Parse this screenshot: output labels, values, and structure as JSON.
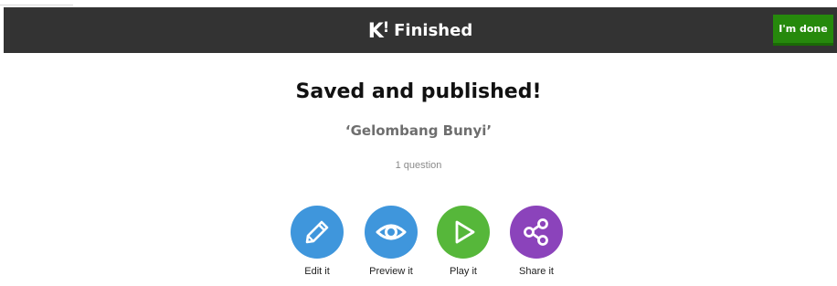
{
  "header": {
    "logo": "K",
    "logo_mark": "!",
    "title": "Finished",
    "done_label": "I'm done"
  },
  "main": {
    "headline": "Saved and published!",
    "quiz_title": "‘Gelombang Bunyi’",
    "question_count": "1 question"
  },
  "actions": [
    {
      "label": "Edit it",
      "icon": "pencil-icon",
      "color": "#3f96dc"
    },
    {
      "label": "Preview it",
      "icon": "eye-icon",
      "color": "#3f96dc"
    },
    {
      "label": "Play it",
      "icon": "play-icon",
      "color": "#56b73a"
    },
    {
      "label": "Share it",
      "icon": "share-icon",
      "color": "#8b43bb"
    }
  ],
  "colors": {
    "topbar": "#333333",
    "done_button": "#26890c"
  }
}
